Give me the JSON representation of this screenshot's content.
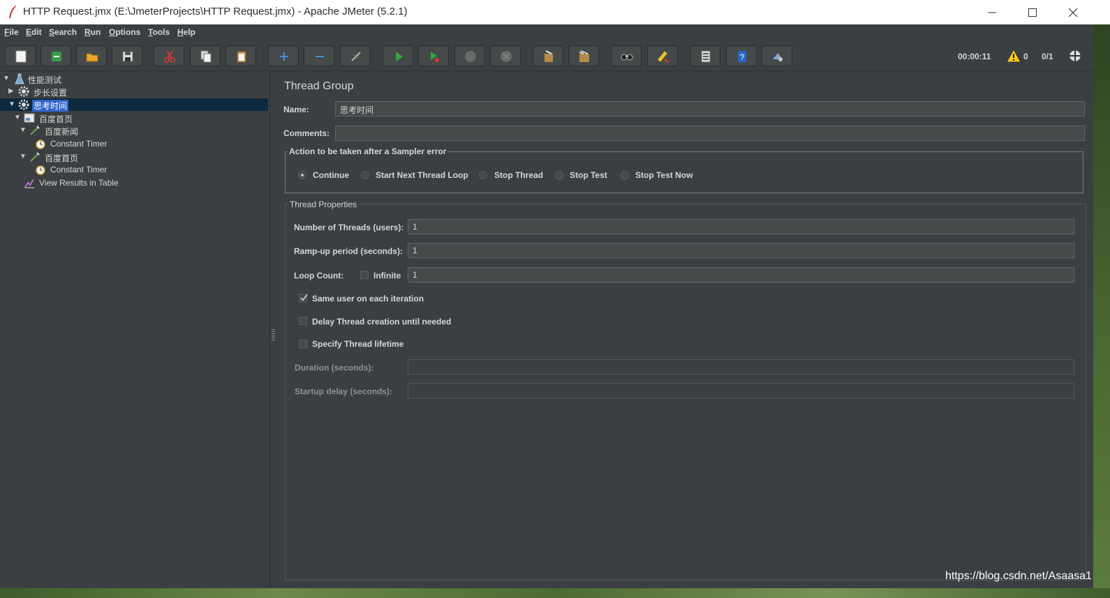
{
  "window": {
    "title": "HTTP Request.jmx (E:\\JmeterProjects\\HTTP Request.jmx) - Apache JMeter (5.2.1)",
    "controls": [
      "minimize-icon",
      "maximize-icon",
      "close-icon"
    ]
  },
  "menu": {
    "items": [
      {
        "mnemonic": "F",
        "rest": "ile"
      },
      {
        "mnemonic": "E",
        "rest": "dit"
      },
      {
        "mnemonic": "S",
        "rest": "earch"
      },
      {
        "mnemonic": "R",
        "rest": "un"
      },
      {
        "mnemonic": "O",
        "rest": "ptions"
      },
      {
        "mnemonic": "T",
        "rest": "ools"
      },
      {
        "mnemonic": "H",
        "rest": "elp"
      }
    ]
  },
  "toolbar": {
    "icons": [
      "new-icon",
      "templates-icon",
      "open-icon",
      "save-icon",
      "cut-icon",
      "copy-icon",
      "paste-icon",
      "expand-icon",
      "collapse-icon",
      "toggle-icon",
      "start-icon",
      "start-no-pauses-icon",
      "stop-icon",
      "shutdown-icon",
      "clear-icon",
      "clear-all-icon",
      "search-icon",
      "reset-search-icon",
      "function-helper-icon",
      "help-icon",
      "remote-icon"
    ],
    "elapsed_time": "00:00:11",
    "warning_count": "0",
    "active_threads": "0/1"
  },
  "tree": {
    "items": [
      {
        "label": "性能测试",
        "icon": "test-plan-icon",
        "expanded": true
      },
      {
        "label": "步长设置",
        "icon": "thread-group-icon",
        "expanded": false
      },
      {
        "label": "思考时间",
        "icon": "thread-group-icon",
        "expanded": true,
        "selected": true
      },
      {
        "label": "百度首页",
        "icon": "transaction-controller-icon",
        "expanded": true
      },
      {
        "label": "百度新闻",
        "icon": "http-sampler-icon",
        "expanded": true
      },
      {
        "label": "Constant Timer",
        "icon": "timer-icon"
      },
      {
        "label": "百度首页",
        "icon": "http-sampler-icon",
        "expanded": true
      },
      {
        "label": "Constant Timer",
        "icon": "timer-icon"
      },
      {
        "label": "View Results in Table",
        "icon": "listener-icon"
      }
    ]
  },
  "panel": {
    "title": "Thread Group",
    "name_label": "Name:",
    "name_value": "思考时间",
    "comments_label": "Comments:",
    "comments_value": "",
    "sampler_error": {
      "legend": "Action to be taken after a Sampler error",
      "options": [
        "Continue",
        "Start Next Thread Loop",
        "Stop Thread",
        "Stop Test",
        "Stop Test Now"
      ],
      "selected": "Continue"
    },
    "thread_properties": {
      "legend": "Thread Properties",
      "threads_label": "Number of Threads (users):",
      "threads_value": "1",
      "rampup_label": "Ramp-up period (seconds):",
      "rampup_value": "1",
      "loop_label": "Loop Count:",
      "infinite_label": "Infinite",
      "infinite_checked": false,
      "loop_value": "1",
      "same_user_label": "Same user on each iteration",
      "same_user_checked": true,
      "delay_label": "Delay Thread creation until needed",
      "delay_checked": false,
      "lifetime_label": "Specify Thread lifetime",
      "lifetime_checked": false,
      "duration_label": "Duration (seconds):",
      "duration_value": "",
      "startup_label": "Startup delay (seconds):",
      "startup_value": ""
    }
  },
  "watermark": "https://blog.csdn.net/Asaasa1"
}
